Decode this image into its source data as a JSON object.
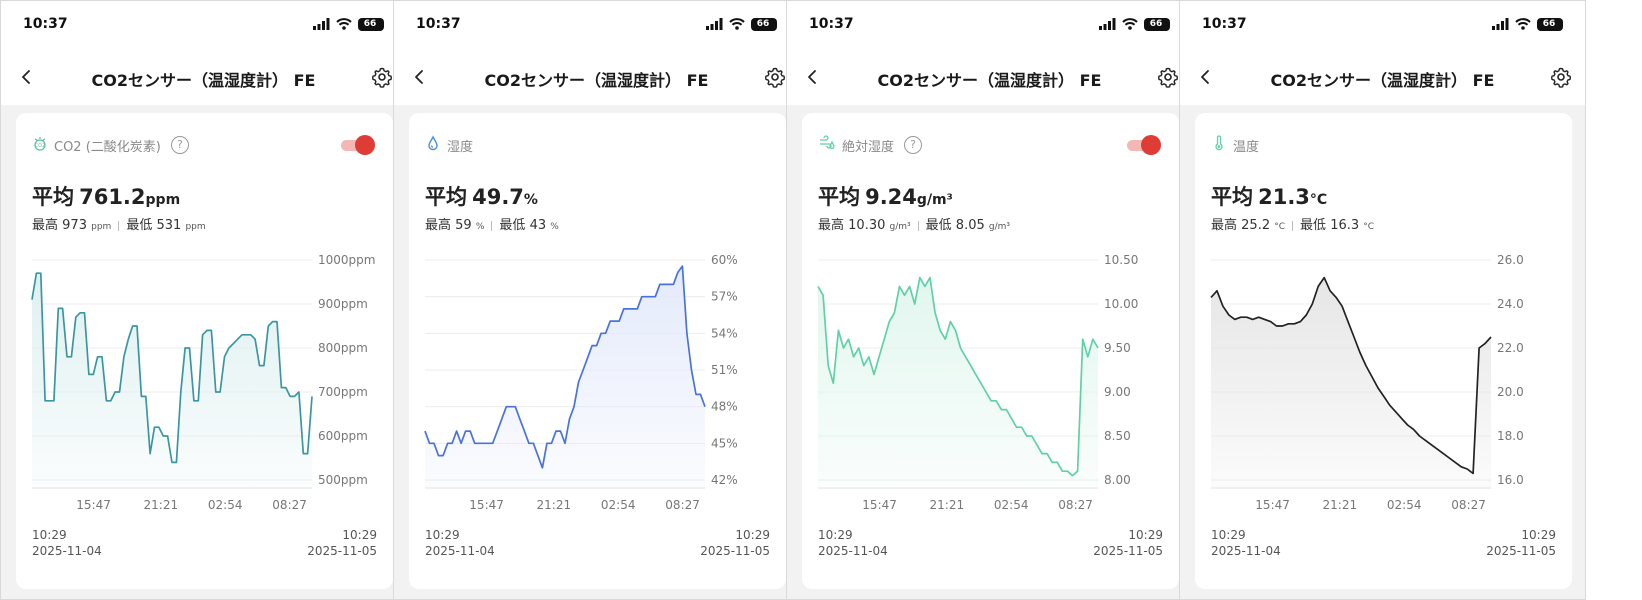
{
  "status": {
    "time": "10:37",
    "battery": "66"
  },
  "screens": [
    {
      "title": "CO2センサー（温湿度計） FE",
      "sensor": "CO2 (二酸化炭素)",
      "icon": "co2-icon",
      "has_help": true,
      "has_toggle": true,
      "avg_label": "平均",
      "avg_value": "761.2",
      "avg_unit": "ppm",
      "max_label": "最高",
      "max_value": "973",
      "max_unit": "ppm",
      "min_label": "最低",
      "min_value": "531",
      "min_unit": "ppm",
      "start_time": "10:29",
      "start_date": "2025-11-04",
      "end_time": "10:29",
      "end_date": "2025-11-05"
    },
    {
      "title": "CO2センサー（温湿度計） FE",
      "sensor": "湿度",
      "icon": "humidity-drop-icon",
      "has_help": false,
      "has_toggle": false,
      "avg_label": "平均",
      "avg_value": "49.7",
      "avg_unit": "%",
      "max_label": "最高",
      "max_value": "59",
      "max_unit": "%",
      "min_label": "最低",
      "min_value": "43",
      "min_unit": "%",
      "start_time": "10:29",
      "start_date": "2025-11-04",
      "end_time": "10:29",
      "end_date": "2025-11-05"
    },
    {
      "title": "CO2センサー（温湿度計） FE",
      "sensor": "絶対湿度",
      "icon": "absolute-humidity-icon",
      "has_help": true,
      "has_toggle": true,
      "avg_label": "平均",
      "avg_value": "9.24",
      "avg_unit": "g/m³",
      "max_label": "最高",
      "max_value": "10.30",
      "max_unit": "g/m³",
      "min_label": "最低",
      "min_value": "8.05",
      "min_unit": "g/m³",
      "start_time": "10:29",
      "start_date": "2025-11-04",
      "end_time": "10:29",
      "end_date": "2025-11-05"
    },
    {
      "title": "CO2センサー（温湿度計） FE",
      "sensor": "温度",
      "icon": "thermometer-icon",
      "has_help": false,
      "has_toggle": false,
      "avg_label": "平均",
      "avg_value": "21.3",
      "avg_unit": "°C",
      "max_label": "最高",
      "max_value": "25.2",
      "max_unit": "°C",
      "min_label": "最低",
      "min_value": "16.3",
      "min_unit": "°C",
      "start_time": "10:29",
      "start_date": "2025-11-04",
      "end_time": "10:29",
      "end_date": "2025-11-05"
    }
  ],
  "chart_data": [
    {
      "type": "area",
      "color": "#3a97a0",
      "fill_color": "#dff0f1",
      "y_ticks": [
        "1000ppm",
        "900ppm",
        "800ppm",
        "700ppm",
        "600ppm",
        "500ppm"
      ],
      "ylim": [
        500,
        1000
      ],
      "x_ticks": [
        "15:47",
        "21:21",
        "02:54",
        "08:27"
      ],
      "x_tick_fractions": [
        0.22,
        0.46,
        0.69,
        0.92
      ],
      "series": [
        {
          "values": [
            910,
            970,
            970,
            680,
            680,
            680,
            890,
            890,
            780,
            780,
            870,
            880,
            880,
            740,
            740,
            780,
            780,
            680,
            680,
            700,
            700,
            780,
            820,
            850,
            850,
            690,
            690,
            560,
            620,
            620,
            600,
            600,
            540,
            540,
            700,
            800,
            800,
            680,
            680,
            830,
            840,
            840,
            700,
            700,
            780,
            800,
            810,
            820,
            830,
            830,
            830,
            820,
            760,
            760,
            850,
            860,
            860,
            710,
            710,
            690,
            690,
            700,
            560,
            560,
            690
          ]
        }
      ]
    },
    {
      "type": "area",
      "color": "#4a72dd",
      "fill_color": "#e4eafb",
      "y_ticks": [
        "60%",
        "57%",
        "54%",
        "51%",
        "48%",
        "45%",
        "42%"
      ],
      "ylim": [
        42,
        60
      ],
      "x_ticks": [
        "15:47",
        "21:21",
        "02:54",
        "08:27"
      ],
      "x_tick_fractions": [
        0.22,
        0.46,
        0.69,
        0.92
      ],
      "series": [
        {
          "values": [
            46,
            45,
            45,
            44,
            44,
            45,
            45,
            46,
            45,
            46,
            46,
            45,
            45,
            45,
            45,
            45,
            46,
            47,
            48,
            48,
            48,
            47,
            46,
            45,
            45,
            44,
            43,
            45,
            45,
            46,
            46,
            45,
            47,
            48,
            50,
            51,
            52,
            53,
            53,
            54,
            54,
            55,
            55,
            55,
            56,
            56,
            56,
            56,
            57,
            57,
            57,
            57,
            58,
            58,
            58,
            58,
            59,
            59.5,
            54,
            51,
            49,
            49,
            48
          ]
        }
      ]
    },
    {
      "type": "area",
      "color": "#5fd1a4",
      "fill_color": "#e1f6ee",
      "y_ticks": [
        "10.50",
        "10.00",
        "9.50",
        "9.00",
        "8.50",
        "8.00"
      ],
      "ylim": [
        8.0,
        10.5
      ],
      "x_ticks": [
        "15:47",
        "21:21",
        "02:54",
        "08:27"
      ],
      "x_tick_fractions": [
        0.22,
        0.46,
        0.69,
        0.92
      ],
      "series": [
        {
          "values": [
            10.2,
            10.1,
            9.3,
            9.1,
            9.7,
            9.5,
            9.6,
            9.4,
            9.5,
            9.3,
            9.4,
            9.2,
            9.4,
            9.6,
            9.8,
            9.9,
            10.2,
            10.1,
            10.2,
            10.0,
            10.3,
            10.2,
            10.3,
            9.9,
            9.7,
            9.6,
            9.8,
            9.7,
            9.5,
            9.4,
            9.3,
            9.2,
            9.1,
            9.0,
            8.9,
            8.9,
            8.8,
            8.8,
            8.7,
            8.6,
            8.6,
            8.5,
            8.5,
            8.4,
            8.3,
            8.3,
            8.2,
            8.2,
            8.1,
            8.1,
            8.05,
            8.1,
            9.6,
            9.4,
            9.6,
            9.5
          ]
        }
      ]
    },
    {
      "type": "area",
      "color": "#222222",
      "fill_color": "#e6e6e6",
      "y_ticks": [
        "26.0",
        "24.0",
        "22.0",
        "20.0",
        "18.0",
        "16.0"
      ],
      "ylim": [
        16.0,
        26.0
      ],
      "x_ticks": [
        "15:47",
        "21:21",
        "02:54",
        "08:27"
      ],
      "x_tick_fractions": [
        0.22,
        0.46,
        0.69,
        0.92
      ],
      "series": [
        {
          "values": [
            24.3,
            24.6,
            23.9,
            23.5,
            23.3,
            23.4,
            23.4,
            23.3,
            23.4,
            23.3,
            23.2,
            23.0,
            23.0,
            23.1,
            23.1,
            23.2,
            23.5,
            24.0,
            24.8,
            25.2,
            24.6,
            24.3,
            23.9,
            23.2,
            22.5,
            21.8,
            21.2,
            20.7,
            20.2,
            19.8,
            19.4,
            19.1,
            18.8,
            18.5,
            18.3,
            18.0,
            17.8,
            17.6,
            17.4,
            17.2,
            17.0,
            16.8,
            16.6,
            16.5,
            16.3,
            22.0,
            22.2,
            22.5
          ]
        }
      ]
    }
  ]
}
